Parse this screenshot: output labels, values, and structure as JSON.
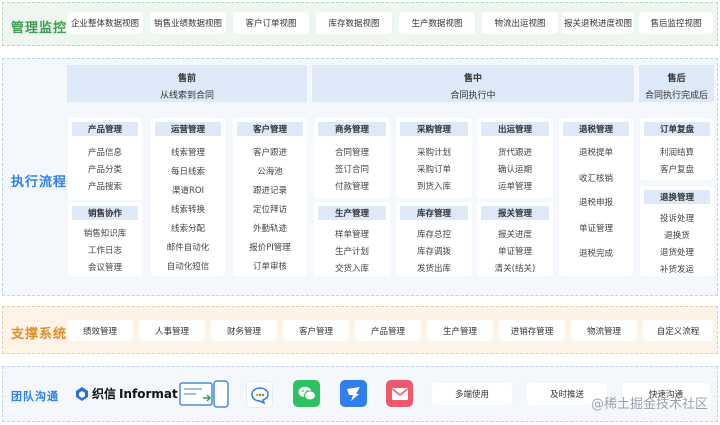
{
  "bands": {
    "monitor": {
      "label": "管理监控",
      "items": [
        "企业整体数据视图",
        "销售业绩数据视图",
        "客户订单视图",
        "库存数据视图",
        "生产数据视图",
        "物流出运视图",
        "报关退税进度视图",
        "售后监控视图"
      ]
    },
    "exec": {
      "label": "执行流程"
    },
    "support": {
      "label": "支撑系统",
      "items": [
        "绩效管理",
        "人事管理",
        "财务管理",
        "客户管理",
        "产品管理",
        "生产管理",
        "进销存管理",
        "物流管理",
        "自定义流程"
      ]
    },
    "team": {
      "label": "团队沟通",
      "brand": "Informat",
      "brand_prefix": "织信",
      "items": [
        "多端使用",
        "及时推送",
        "快速沟通"
      ]
    }
  },
  "phases": [
    {
      "title": "售前",
      "sub": "从线索到合同"
    },
    {
      "title": "售中",
      "sub": "合同执行中"
    },
    {
      "title": "售后",
      "sub": "合同执行完成后"
    }
  ],
  "cards": {
    "product": {
      "title": "产品管理",
      "items": [
        "产品信息",
        "产品分类",
        "产品搜索"
      ]
    },
    "sales_collab": {
      "title": "销售协作",
      "items": [
        "销售知识库",
        "工作日志",
        "会议管理"
      ]
    },
    "ops": {
      "title": "运营管理",
      "items": [
        "线索管理",
        "每日线索",
        "渠道ROI",
        "线索转换",
        "线索分配",
        "邮件自动化",
        "自动化短信"
      ]
    },
    "customer": {
      "title": "客户管理",
      "items": [
        "客户跟进",
        "公海池",
        "跟进记录",
        "定位拜访",
        "外勤轨迹",
        "报价PI管理",
        "订单审核"
      ]
    },
    "business": {
      "title": "商务管理",
      "items": [
        "合同管理",
        "签订合同",
        "付款管理"
      ]
    },
    "purchase": {
      "title": "采购管理",
      "items": [
        "采购计划",
        "采购订单",
        "到货入库"
      ]
    },
    "shipping": {
      "title": "出运管理",
      "items": [
        "货代跟进",
        "确认运期",
        "运单管理"
      ]
    },
    "production": {
      "title": "生产管理",
      "items": [
        "样单管理",
        "生产计划",
        "交货入库"
      ]
    },
    "inventory": {
      "title": "库存管理",
      "items": [
        "库存总控",
        "库存调拨",
        "发货出库"
      ]
    },
    "customs": {
      "title": "报关管理",
      "items": [
        "报关进度",
        "单证管理",
        "清关(结关)"
      ]
    },
    "tax": {
      "title": "退税管理",
      "items": [
        "退税提单",
        "收汇核销",
        "退税申报",
        "单证管理",
        "退税完成"
      ]
    },
    "review": {
      "title": "订单复盘",
      "items": [
        "利润结算",
        "客户复盘"
      ]
    },
    "returns": {
      "title": "退换管理",
      "items": [
        "投诉处理",
        "退换货",
        "退货处理",
        "补货发运"
      ]
    }
  },
  "watermark": "@稀土掘金技术社区",
  "colors": {
    "accent_green": "#3d9d52",
    "accent_blue": "#2f80ed",
    "accent_orange": "#e08e2b",
    "phase_bg": "#dde8f8"
  }
}
